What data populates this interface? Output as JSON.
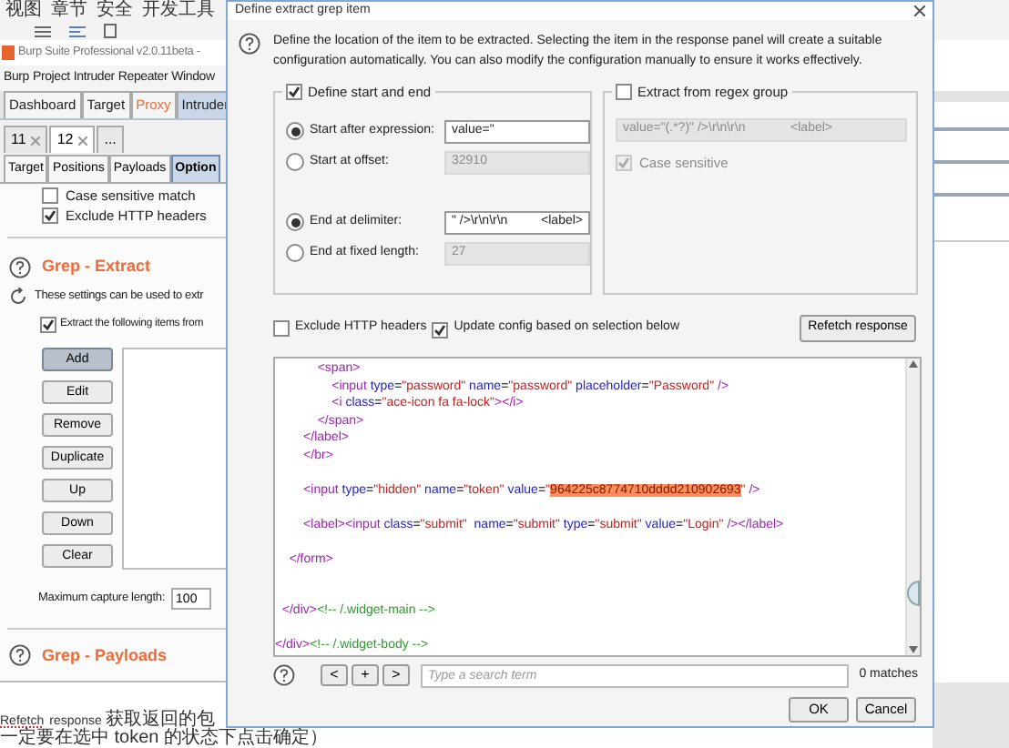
{
  "browser_menu": [
    "视图",
    "章节",
    "安全",
    "开发工具"
  ],
  "app": {
    "title": "Burp Suite Professional v2.0.11beta -",
    "menu": [
      "Burp",
      "Project",
      "Intruder",
      "Repeater",
      "Window"
    ],
    "main_tabs": [
      {
        "label": "Dashboard",
        "selected": false,
        "alert": false
      },
      {
        "label": "Target",
        "selected": false,
        "alert": false
      },
      {
        "label": "Proxy",
        "selected": false,
        "alert": true
      },
      {
        "label": "Intruder",
        "selected": true,
        "alert": false
      }
    ],
    "attack_tabs": [
      {
        "label": "11",
        "kind": "attack",
        "selected": false
      },
      {
        "label": "12",
        "kind": "attack",
        "selected": true
      },
      {
        "label": "...",
        "kind": "new",
        "selected": false
      }
    ],
    "sub_tabs": [
      {
        "label": "Target",
        "selected": false
      },
      {
        "label": "Positions",
        "selected": false
      },
      {
        "label": "Payloads",
        "selected": false
      },
      {
        "label": "Option",
        "selected": true
      }
    ],
    "match_options": [
      {
        "label": "Case sensitive match",
        "checked": false
      },
      {
        "label": "Exclude HTTP headers",
        "checked": true
      }
    ],
    "grep_extract": {
      "title": "Grep - Extract",
      "description": "These settings can be used to extr",
      "extract_option": {
        "label": "Extract the following items from",
        "checked": true
      },
      "buttons": [
        {
          "label": "Add",
          "selected": true
        },
        {
          "label": "Edit",
          "selected": false
        },
        {
          "label": "Remove",
          "selected": false
        },
        {
          "label": "Duplicate",
          "selected": false
        },
        {
          "label": "Up",
          "selected": false
        },
        {
          "label": "Down",
          "selected": false
        },
        {
          "label": "Clear",
          "selected": false
        }
      ],
      "max_length_label": "Maximum capture length:",
      "max_length_value": "100"
    },
    "grep_payloads": {
      "title": "Grep - Payloads"
    }
  },
  "note_lines": [
    {
      "kind": "mixed",
      "lead": "Refetch",
      "text": "response 获取返回的包"
    },
    {
      "kind": "plain",
      "text": "一定要在选中 token 的状态下点击确定）"
    }
  ],
  "dialog": {
    "title": "Define extract grep item",
    "description": "Define the location of the item to be extracted. Selecting the item in the response panel will create a suitable configuration automatically. You can also modify the configuration manually to ensure it works effectively.",
    "start_end": {
      "label": "Define start and end",
      "checked": true,
      "start_options": [
        {
          "label": "Start after expression:",
          "selected": true,
          "value": "value=\""
        },
        {
          "label": "Start at offset:",
          "selected": false,
          "value": "32910"
        }
      ],
      "end_options": [
        {
          "label": "End at delimiter:",
          "selected": true,
          "value": "\" />\\r\\n\\r\\n",
          "extra": "<label>"
        },
        {
          "label": "End at fixed length:",
          "selected": false,
          "value": "27"
        }
      ]
    },
    "regex_group": {
      "label": "Extract from regex group",
      "checked": false,
      "value": "value=\"(.*?)\" />\\r\\n\\r\\n",
      "extra": "<label>",
      "case_sensitive": {
        "label": "Case sensitive",
        "checked": true
      }
    },
    "exclude_headers": {
      "label": "Exclude HTTP headers",
      "checked": false
    },
    "update_config": {
      "label": "Update config based on selection below",
      "checked": true
    },
    "refetch_button": "Refetch response",
    "code_lines": [
      {
        "kind": "code",
        "segments": [
          {
            "kind": "tag",
            "text": "            <span>"
          }
        ]
      },
      {
        "kind": "code",
        "segments": [
          {
            "kind": "tag",
            "text": "                <input "
          },
          {
            "kind": "attr",
            "text": "type"
          },
          {
            "kind": "plain",
            "text": "="
          },
          {
            "kind": "value",
            "text": "\"password\""
          },
          {
            "kind": "attr",
            "text": " name"
          },
          {
            "kind": "plain",
            "text": "="
          },
          {
            "kind": "value",
            "text": "\"password\""
          },
          {
            "kind": "attr",
            "text": " placeholder"
          },
          {
            "kind": "plain",
            "text": "="
          },
          {
            "kind": "value",
            "text": "\"Password\""
          },
          {
            "kind": "tag",
            "text": " />"
          }
        ]
      },
      {
        "kind": "code",
        "segments": [
          {
            "kind": "tag",
            "text": "                <i "
          },
          {
            "kind": "attr",
            "text": "class"
          },
          {
            "kind": "plain",
            "text": "="
          },
          {
            "kind": "value",
            "text": "\"ace-icon fa fa-lock\""
          },
          {
            "kind": "tag",
            "text": "></i>"
          }
        ]
      },
      {
        "kind": "code",
        "segments": [
          {
            "kind": "tag",
            "text": "            </span>"
          }
        ]
      },
      {
        "kind": "code",
        "segments": [
          {
            "kind": "tag",
            "text": "        </label>"
          }
        ]
      },
      {
        "kind": "code",
        "segments": [
          {
            "kind": "tag",
            "text": "        </br>"
          }
        ]
      },
      {
        "kind": "blank"
      },
      {
        "kind": "code",
        "segments": [
          {
            "kind": "tag",
            "text": "        <input "
          },
          {
            "kind": "attr",
            "text": "type"
          },
          {
            "kind": "plain",
            "text": "="
          },
          {
            "kind": "value",
            "text": "\"hidden\""
          },
          {
            "kind": "attr",
            "text": " name"
          },
          {
            "kind": "plain",
            "text": "="
          },
          {
            "kind": "value",
            "text": "\"token\""
          },
          {
            "kind": "attr",
            "text": " value"
          },
          {
            "kind": "plain",
            "text": "="
          },
          {
            "kind": "value",
            "text": "\""
          },
          {
            "kind": "highlight",
            "text": "964225c8774710dddd210902693"
          },
          {
            "kind": "value",
            "text": "\""
          },
          {
            "kind": "tag",
            "text": " />"
          }
        ]
      },
      {
        "kind": "blank"
      },
      {
        "kind": "code",
        "segments": [
          {
            "kind": "tag",
            "text": "        <label><input "
          },
          {
            "kind": "attr",
            "text": "class"
          },
          {
            "kind": "plain",
            "text": "="
          },
          {
            "kind": "value",
            "text": "\"submit\""
          },
          {
            "kind": "attr",
            "text": "  name"
          },
          {
            "kind": "plain",
            "text": "="
          },
          {
            "kind": "value",
            "text": "\"submit\""
          },
          {
            "kind": "attr",
            "text": " type"
          },
          {
            "kind": "plain",
            "text": "="
          },
          {
            "kind": "value",
            "text": "\"submit\""
          },
          {
            "kind": "attr",
            "text": " value"
          },
          {
            "kind": "plain",
            "text": "="
          },
          {
            "kind": "value",
            "text": "\"Login\""
          },
          {
            "kind": "tag",
            "text": " /></label>"
          }
        ]
      },
      {
        "kind": "blank"
      },
      {
        "kind": "code",
        "segments": [
          {
            "kind": "tag",
            "text": "    </form>"
          }
        ]
      },
      {
        "kind": "blank"
      },
      {
        "kind": "blank"
      },
      {
        "kind": "code",
        "segments": [
          {
            "kind": "tag",
            "text": "  </div>"
          },
          {
            "kind": "comment",
            "text": "<!-- /.widget-main -->"
          }
        ]
      },
      {
        "kind": "blank"
      },
      {
        "kind": "code",
        "segments": [
          {
            "kind": "tag",
            "text": "</div>"
          },
          {
            "kind": "comment",
            "text": "<!-- /.widget-body -->"
          }
        ]
      }
    ],
    "search": {
      "buttons": [
        "<",
        "+",
        ">"
      ],
      "placeholder": "Type a search term",
      "matches": "0 matches"
    },
    "actions": [
      "OK",
      "Cancel"
    ]
  }
}
